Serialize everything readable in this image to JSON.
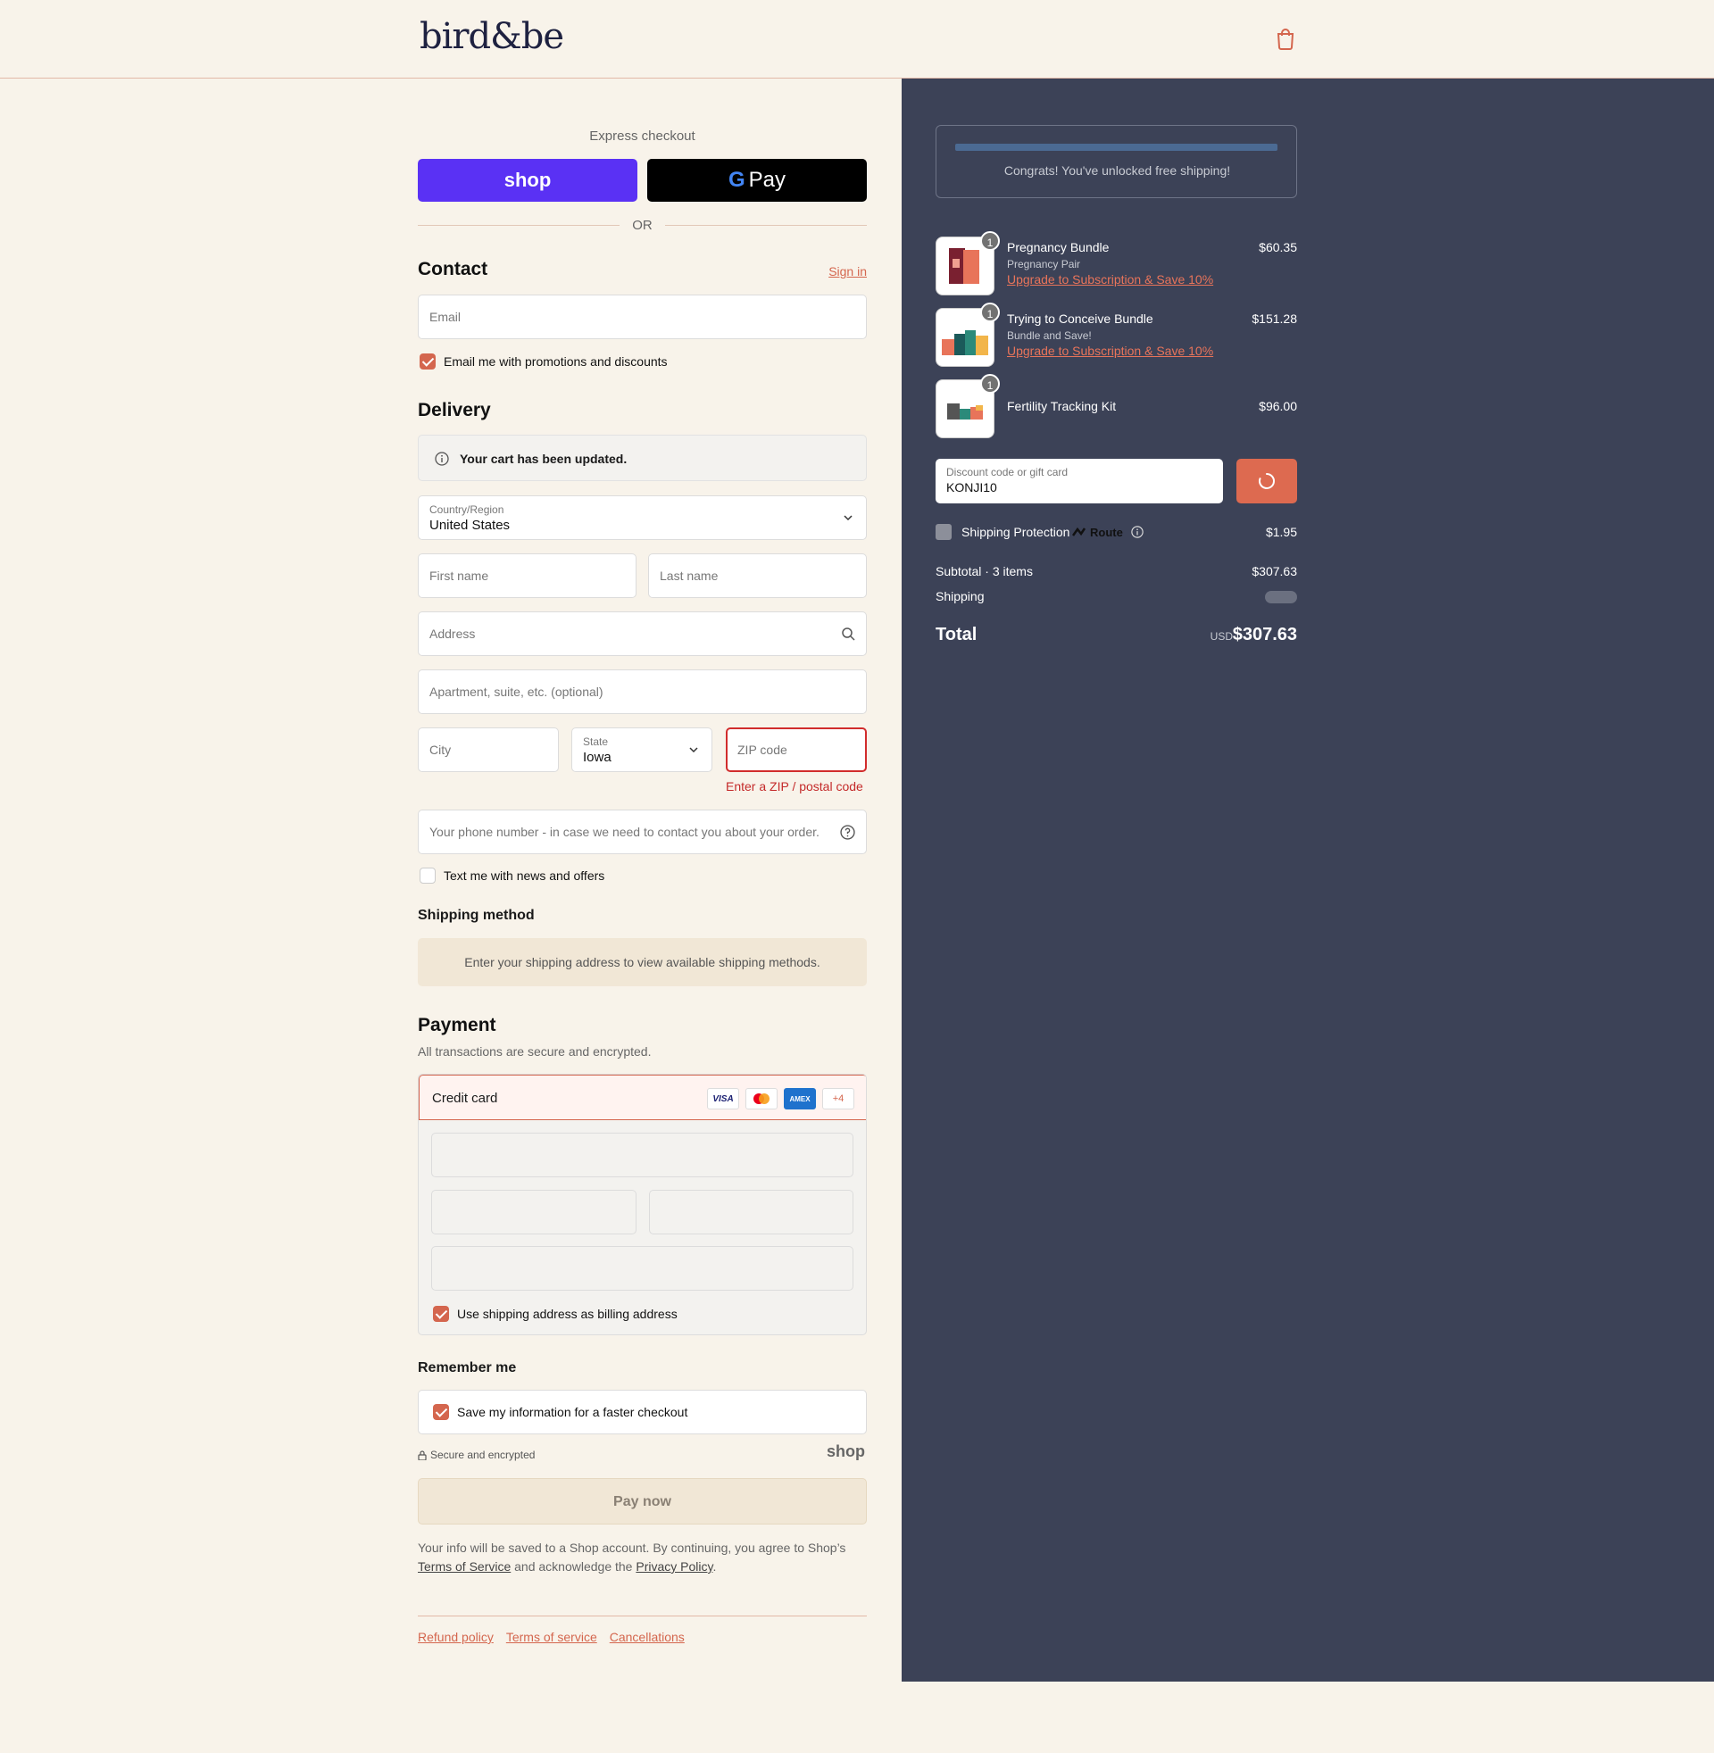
{
  "header": {
    "logo": "bird&be",
    "cart_icon": "shopping-bag-icon"
  },
  "express": {
    "label": "Express checkout",
    "shop_label": "shop",
    "gpay_g": "G",
    "gpay_label": "Pay",
    "or_label": "OR"
  },
  "contact": {
    "title": "Contact",
    "sign_in": "Sign in",
    "email_placeholder": "Email",
    "promo_label": "Email me with promotions and discounts"
  },
  "delivery": {
    "title": "Delivery",
    "notice": "Your cart has been updated.",
    "country_label": "Country/Region",
    "country_value": "United States",
    "first_name_placeholder": "First name",
    "last_name_placeholder": "Last name",
    "address_placeholder": "Address",
    "apartment_placeholder": "Apartment, suite, etc. (optional)",
    "city_placeholder": "City",
    "state_label": "State",
    "state_value": "Iowa",
    "zip_placeholder": "ZIP code",
    "zip_error": "Enter a ZIP / postal code",
    "phone_placeholder": "Your phone number - in case we need to contact you about your order.",
    "text_offers_label": "Text me with news and offers"
  },
  "shipping_method": {
    "title": "Shipping method",
    "message": "Enter your shipping address to view available shipping methods."
  },
  "payment": {
    "title": "Payment",
    "subtitle": "All transactions are secure and encrypted.",
    "credit_card_label": "Credit card",
    "card_logos": [
      "VISA",
      "MC",
      "AMEX",
      "+4"
    ],
    "billing_label": "Use shipping address as billing address"
  },
  "remember": {
    "title": "Remember me",
    "save_label": "Save my information for a faster checkout",
    "secure_label": "Secure and encrypted",
    "shop_label": "shop"
  },
  "pay_now": "Pay now",
  "legal": {
    "text1": "Your info will be saved to a Shop account. By continuing, you agree to Shop’s ",
    "terms": "Terms of Service",
    "text2": " and acknowledge the ",
    "privacy": "Privacy Policy",
    "text3": "."
  },
  "footer": {
    "links": [
      "Refund policy",
      "Terms of service",
      "Cancellations"
    ]
  },
  "summary": {
    "free_shipping": "Congrats! You've unlocked free shipping!",
    "items": [
      {
        "name": "Pregnancy Bundle",
        "subtitle": "Pregnancy Pair",
        "upgrade": "Upgrade to Subscription & Save 10%",
        "price": "$60.35",
        "qty": "1"
      },
      {
        "name": "Trying to Conceive Bundle",
        "subtitle": "Bundle and Save!",
        "upgrade": "Upgrade to Subscription & Save 10%",
        "price": "$151.28",
        "qty": "1"
      },
      {
        "name": "Fertility Tracking Kit",
        "price": "$96.00",
        "qty": "1"
      }
    ],
    "discount_label": "Discount code or gift card",
    "discount_value": "KONJI10",
    "protection_label": "Shipping Protection",
    "protection_brand": "Route",
    "protection_price": "$1.95",
    "subtotal_label": "Subtotal · 3 items",
    "subtotal_value": "$307.63",
    "shipping_label": "Shipping",
    "total_label": "Total",
    "currency": "USD",
    "total_value": "$307.63"
  },
  "colors": {
    "accent": "#d4664e",
    "panel": "#3c4257",
    "background": "#f8f3ea",
    "shop_purple": "#5a31f4",
    "error": "#d12c2c"
  }
}
